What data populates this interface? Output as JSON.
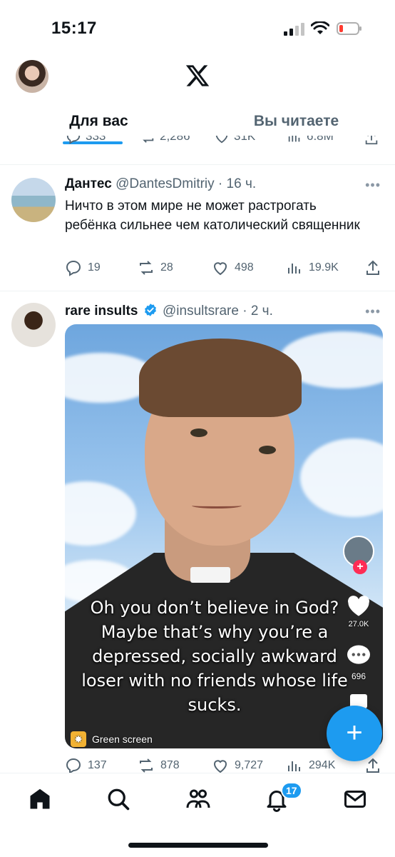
{
  "status_bar": {
    "time": "15:17"
  },
  "header": {
    "logo": "x-logo-icon",
    "tabs": [
      {
        "label": "Для вас",
        "active": true
      },
      {
        "label": "Вы читаете",
        "active": false
      }
    ]
  },
  "prev_tweet": {
    "actions": {
      "replies": "333",
      "reposts": "2,286",
      "likes": "31K",
      "views": "6.8M"
    }
  },
  "tweets": [
    {
      "name": "Дантес",
      "handle": "@DantesDmitriy",
      "time": "16 ч.",
      "text": "Ничто в этом мире не может растрогать ребёнка сильнее чем католический священник",
      "actions": {
        "replies": "19",
        "reposts": "28",
        "likes": "498",
        "views": "19.9K"
      }
    },
    {
      "name": "rare insults",
      "verified": true,
      "handle": "@insultsrare",
      "time": "2 ч.",
      "media": {
        "caption": "Oh you don’t believe in God? Maybe that’s why you’re a depressed, socially awkward loser with no friends whose life sucks.",
        "likes": "27.0K",
        "comments": "696",
        "effect_label": "Green screen"
      },
      "actions": {
        "replies": "137",
        "reposts": "878",
        "likes": "9,727",
        "views": "294K"
      }
    }
  ],
  "fab": {
    "label": "+"
  },
  "bottom_nav": {
    "items": [
      "home-icon",
      "search-icon",
      "communities-icon",
      "notifications-icon",
      "messages-icon"
    ],
    "notifications_badge": "17"
  },
  "colors": {
    "accent": "#1d9bf0",
    "secondary_text": "#536471",
    "primary_text": "#0f1419"
  }
}
